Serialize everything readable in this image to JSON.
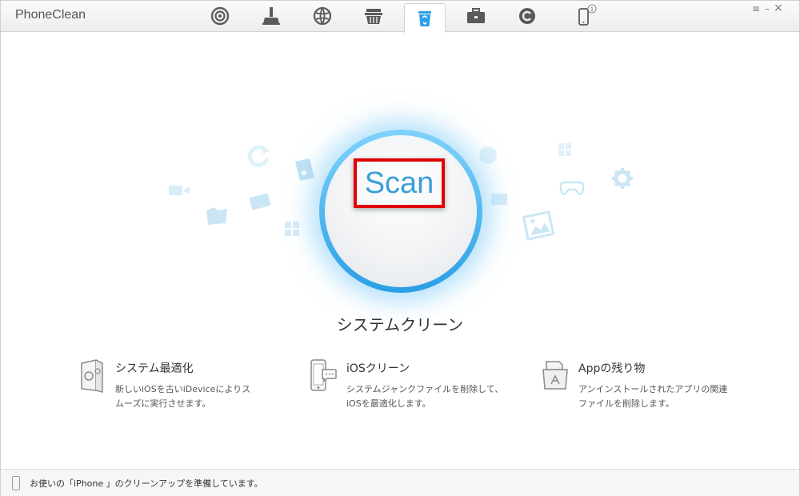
{
  "app": {
    "title": "PhoneClean"
  },
  "toolbar": {
    "tabs": [
      {
        "icon": "wireless-icon"
      },
      {
        "icon": "broom-icon"
      },
      {
        "icon": "globe-icon"
      },
      {
        "icon": "basket-icon"
      },
      {
        "icon": "recycle-bin-icon",
        "active": true
      },
      {
        "icon": "toolbox-icon"
      },
      {
        "icon": "restore-icon"
      },
      {
        "icon": "phone-icon",
        "badge": "1"
      }
    ]
  },
  "window_controls": {
    "menu": "≡",
    "minimize": "–",
    "close": "×"
  },
  "main": {
    "scan_label": "Scan",
    "section_title": "システムクリーン",
    "features": [
      {
        "icon": "system-optimize-icon",
        "title": "システム最適化",
        "desc_line1": "新しいiOSを古いiDeviceによりス",
        "desc_line2": "ムーズに実行させます。"
      },
      {
        "icon": "ios-clean-icon",
        "title": "iOSクリーン",
        "desc_line1": "システムジャンクファイルを削除して、",
        "desc_line2": "iOSを最適化します。"
      },
      {
        "icon": "app-leftovers-icon",
        "title": "Appの残り物",
        "desc_line1": "アンインストールされたアプリの関連",
        "desc_line2": "ファイルを削除します。"
      }
    ]
  },
  "status": {
    "text": "お使いの「iPhone 」のクリーンアップを準備しています。"
  },
  "colors": {
    "accent": "#2a9fe6",
    "highlight": "#e00000",
    "scan_text": "#3b9fd6"
  }
}
